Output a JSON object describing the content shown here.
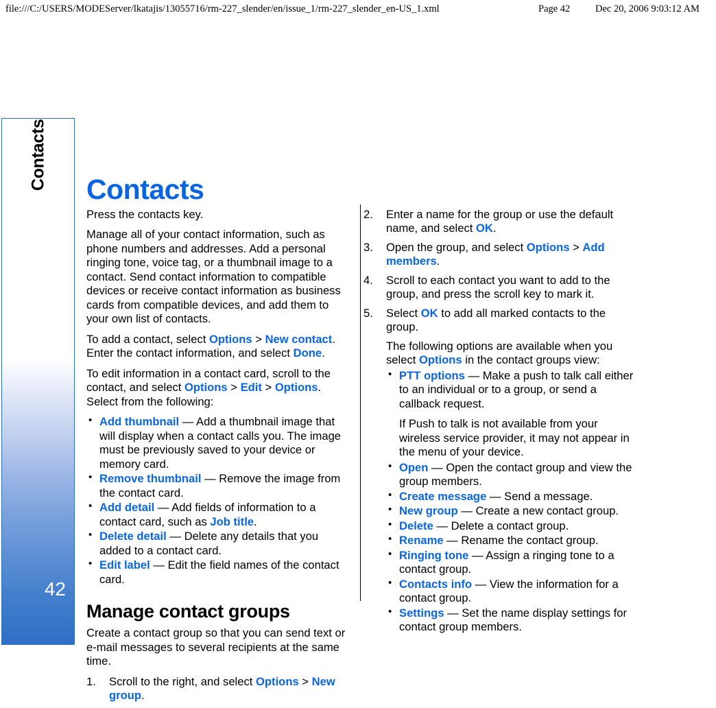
{
  "print_header": {
    "url": "file:///C:/USERS/MODEServer/lkatajis/13055716/rm-227_slender/en/issue_1/rm-227_slender_en-US_1.xml",
    "page_label": "Page 42",
    "timestamp": "Dec 20, 2006 9:03:12 AM"
  },
  "side_tab": {
    "chapter_label": "Contacts",
    "page_number": "42"
  },
  "colors": {
    "accent_blue": "#0a66e0",
    "tab_blue": "#2f6fc4",
    "tab_border": "#2f6fb5",
    "text": "#000000"
  },
  "page": {
    "title": "Contacts"
  },
  "left_column": {
    "intro": "Press the contacts key.",
    "overview": "Manage all of your contact information, such as phone numbers and addresses. Add a personal ringing tone, voice tag, or a thumbnail image to a contact. Send contact information to compatible devices or receive contact information as business cards from compatible devices, and add them to your own list of contacts.",
    "add_contact": {
      "p1": "To add a contact, select ",
      "ui1": "Options",
      "sep1": " > ",
      "ui2": "New contact",
      "p2": ". Enter the contact information, and select ",
      "ui3": "Done",
      "p3": "."
    },
    "edit_intro": {
      "p1": "To edit information in a contact card, scroll to the contact, and select ",
      "ui1": "Options",
      "sep1": " > ",
      "ui2": "Edit",
      "sep2": " > ",
      "ui3": "Options",
      "p2": ". Select from the following:"
    },
    "edit_options": [
      {
        "term": "Add thumbnail",
        "dash": " — ",
        "desc": "Add a thumbnail image that will display when a contact calls you. The image must be previously saved to your device or memory card."
      },
      {
        "term": "Remove thumbnail",
        "dash": " — ",
        "desc": "Remove the image from the contact card."
      },
      {
        "term": "Add detail",
        "dash": " — ",
        "desc": "Add fields of information to a contact card, such as ",
        "inline_ui": "Job title",
        "desc_tail": "."
      },
      {
        "term": "Delete detail",
        "dash": " — ",
        "desc": "Delete any details that you added to a contact card."
      },
      {
        "term": "Edit label",
        "dash": " — ",
        "desc": "Edit the field names of the contact card."
      }
    ],
    "groups_heading": "Manage contact groups",
    "groups_intro": "Create a contact group so that you can send text or e-mail messages to several recipients at the same time.",
    "step1": {
      "num": "1.",
      "p1": "Scroll to the right, and select ",
      "ui1": "Options",
      "sep1": " > ",
      "ui2": "New group",
      "p2": "."
    }
  },
  "right_column": {
    "step2": {
      "num": "2.",
      "p1": "Enter a name for the group or use the default name, and select ",
      "ui1": "OK",
      "p2": "."
    },
    "step3": {
      "num": "3.",
      "p1": "Open the group, and select ",
      "ui1": "Options",
      "sep1": " > ",
      "ui2": "Add members",
      "p2": "."
    },
    "step4": {
      "num": "4.",
      "p1": "Scroll to each contact you want to add to the group, and press the scroll key to mark it."
    },
    "step5": {
      "num": "5.",
      "p1": "Select ",
      "ui1": "OK",
      "p2": " to add all marked contacts to the group."
    },
    "options_intro": {
      "p1": "The following options are available when you select ",
      "ui1": "Options",
      "p2": " in the contact groups view:"
    },
    "group_options": [
      {
        "term": "PTT options",
        "dash": " — ",
        "desc": "Make a push to talk call either to an individual or to a group, or send a callback request.",
        "note": "If Push to talk is not available from your wireless service provider, it may not appear in the menu of your device."
      },
      {
        "term": "Open",
        "dash": " — ",
        "desc": "Open the contact group and view the group members."
      },
      {
        "term": "Create message",
        "dash": " — ",
        "desc": "Send a message."
      },
      {
        "term": "New group",
        "dash": " — ",
        "desc": "Create a new contact group."
      },
      {
        "term": "Delete",
        "dash": " — ",
        "desc": "Delete a contact group."
      },
      {
        "term": "Rename",
        "dash": " — ",
        "desc": "Rename the contact group."
      },
      {
        "term": "Ringing tone",
        "dash": " — ",
        "desc": "Assign a ringing tone to a contact group."
      },
      {
        "term": "Contacts info",
        "dash": " — ",
        "desc": "View the information for a contact group."
      },
      {
        "term": "Settings",
        "dash": " — ",
        "desc": "Set the name display settings for contact group members."
      }
    ]
  }
}
